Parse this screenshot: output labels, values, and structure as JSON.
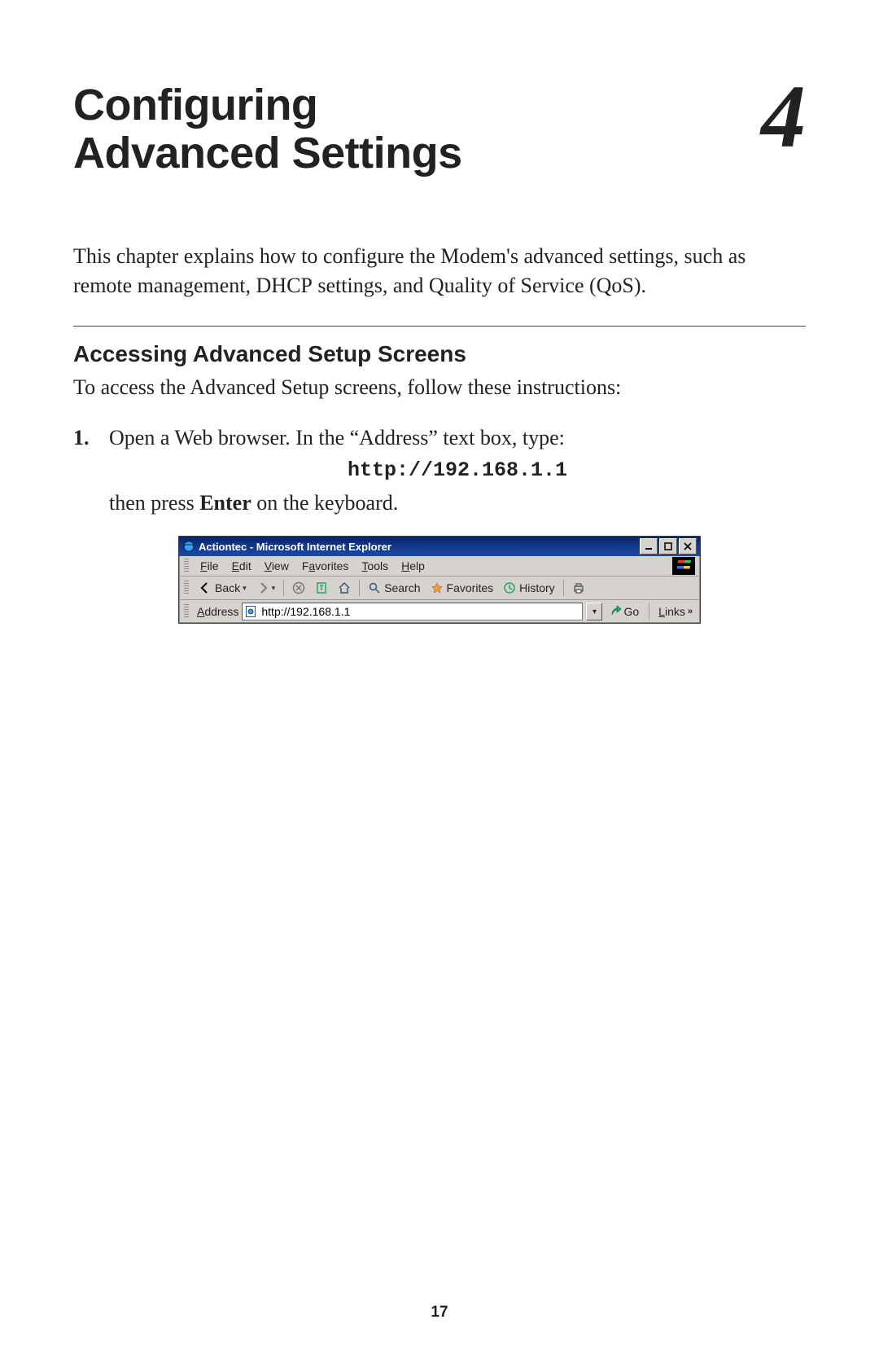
{
  "chapter": {
    "title_line1": "Configuring",
    "title_line2": "Advanced Settings",
    "number": "4"
  },
  "intro": {
    "text_before_dhcp": "This chapter explains how to configure the Modem's advanced settings, such as remote management, ",
    "dhcp": "DHCP",
    "text_after_dhcp": " settings, and Quality of Service (QoS)."
  },
  "section": {
    "heading": "Accessing Advanced Setup Screens",
    "intro": "To access the Advanced Setup screens, follow these instructions:"
  },
  "step1": {
    "num": "1.",
    "line1": "Open a Web browser. In the “Address” text box, type:",
    "code": "http://192.168.1.1",
    "line2_a": "then press ",
    "line2_bold": "Enter",
    "line2_b": " on the keyboard."
  },
  "page_number": "17",
  "ie": {
    "title": "Actiontec - Microsoft Internet Explorer",
    "menus": {
      "file": {
        "u": "F",
        "rest": "ile"
      },
      "edit": {
        "u": "E",
        "rest": "dit"
      },
      "view": {
        "u": "V",
        "rest": "iew"
      },
      "favorites": {
        "pre": "F",
        "u": "a",
        "rest": "vorites"
      },
      "tools": {
        "u": "T",
        "rest": "ools"
      },
      "help": {
        "u": "H",
        "rest": "elp"
      }
    },
    "toolbar": {
      "back": "Back",
      "search": "Search",
      "favorites": "Favorites",
      "history": "History"
    },
    "address": {
      "label_u": "A",
      "label_rest": "ddress",
      "value": "http://192.168.1.1",
      "go": "Go",
      "links_u": "L",
      "links_rest": "inks"
    }
  }
}
